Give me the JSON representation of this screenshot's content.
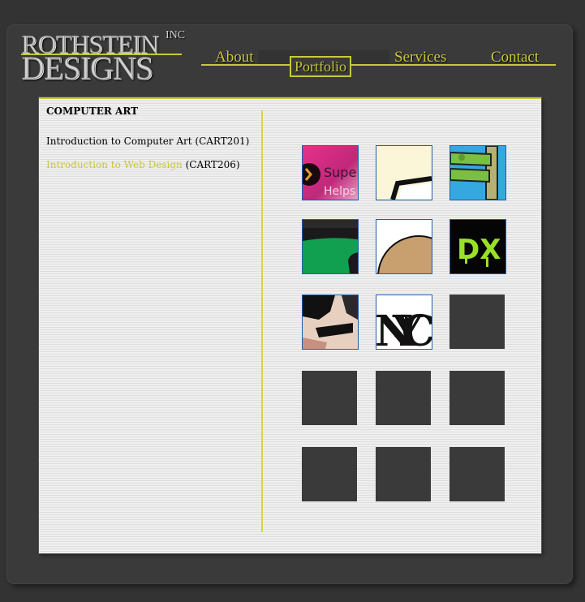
{
  "logo": {
    "line1": "ROTHSTEIN",
    "line2": "DESIGNS",
    "suffix": "INC"
  },
  "nav": {
    "about": "About",
    "portfolio": "Portfolio",
    "services": "Services",
    "contact": "Contact"
  },
  "content": {
    "heading": "COMPUTER ART",
    "item1": "Introduction to Computer Art (CART201)",
    "item2_link": "Introduction to Web Design",
    "item2_code": " (CART206)"
  },
  "thumbnails": {
    "t1_text_a": "Supe",
    "t1_text_b": "Helps",
    "t6_text": "DX",
    "t8_text": "NYC"
  },
  "colors": {
    "accent": "#c9c838",
    "frame": "#3a3a3a",
    "background": "#333333"
  }
}
